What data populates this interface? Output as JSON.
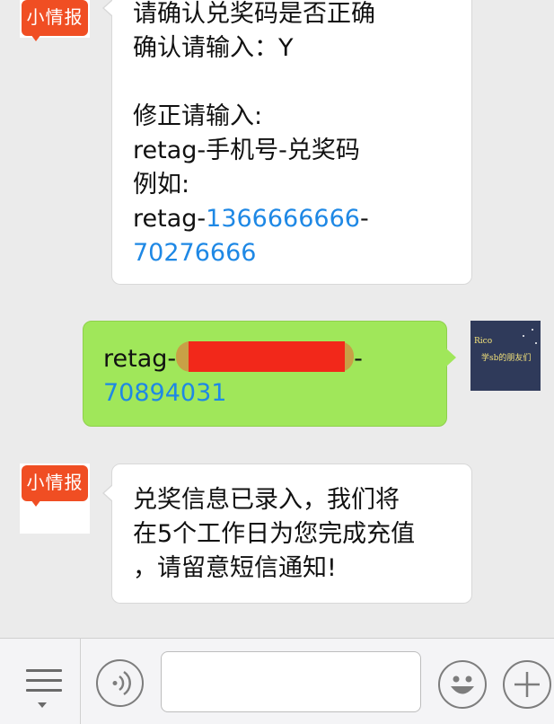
{
  "colors": {
    "badge_orange": "#f04e23",
    "link_blue": "#1e88e5",
    "sent_bubble_green": "#a0e75a",
    "redaction_red": "#f2281a"
  },
  "messages": [
    {
      "sender": "小情报",
      "lines_plain": [
        "请确认兑奖码是否正确",
        "确认请输入：Y",
        "",
        "修正请输入:",
        "retag-手机号-兑奖码",
        "例如:"
      ],
      "example_prefix": "retag-",
      "example_phone": "1366666666",
      "example_dash": "-",
      "example_code": "70276666"
    },
    {
      "sender": "me",
      "prefix": "retag-",
      "suffix": "-",
      "code": "70894031"
    },
    {
      "sender": "小情报",
      "lines": [
        "兑奖信息已录入，我们将",
        "在5个工作日为您完成充值",
        "，请留意短信通知!"
      ]
    }
  ],
  "user_avatar_text": [
    "Rico",
    "学sb的朋友们"
  ],
  "bottombar": {
    "input_value": "",
    "icons": [
      "menu-icon",
      "voice-icon",
      "emoji-icon",
      "plus-icon"
    ]
  }
}
